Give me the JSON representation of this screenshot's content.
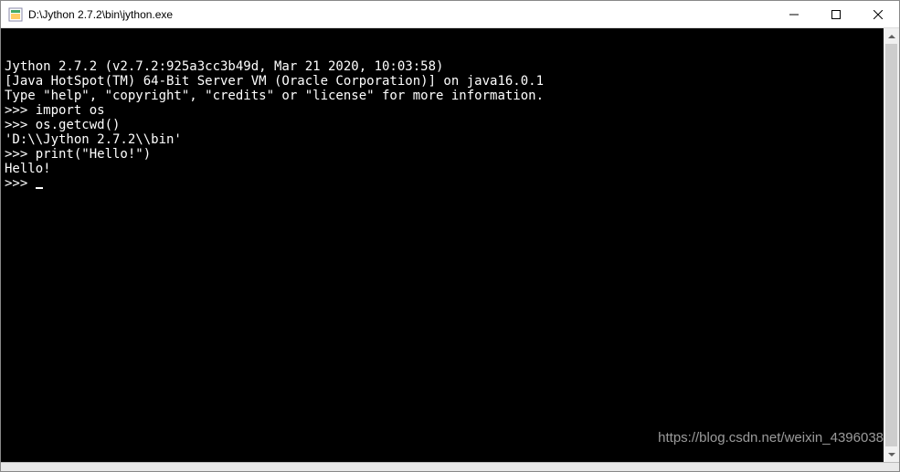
{
  "window": {
    "title": "D:\\Jython 2.7.2\\bin\\jython.exe",
    "controls": {
      "minimize": "—",
      "maximize": "☐",
      "close": "✕"
    }
  },
  "terminal": {
    "lines": [
      "Jython 2.7.2 (v2.7.2:925a3cc3b49d, Mar 21 2020, 10:03:58)",
      "[Java HotSpot(TM) 64-Bit Server VM (Oracle Corporation)] on java16.0.1",
      "Type \"help\", \"copyright\", \"credits\" or \"license\" for more information.",
      ">>> import os",
      ">>> os.getcwd()",
      "'D:\\\\Jython 2.7.2\\\\bin'",
      ">>> print(\"Hello!\")",
      "Hello!",
      ">>> "
    ]
  },
  "watermark": "https://blog.csdn.net/weixin_4396038"
}
